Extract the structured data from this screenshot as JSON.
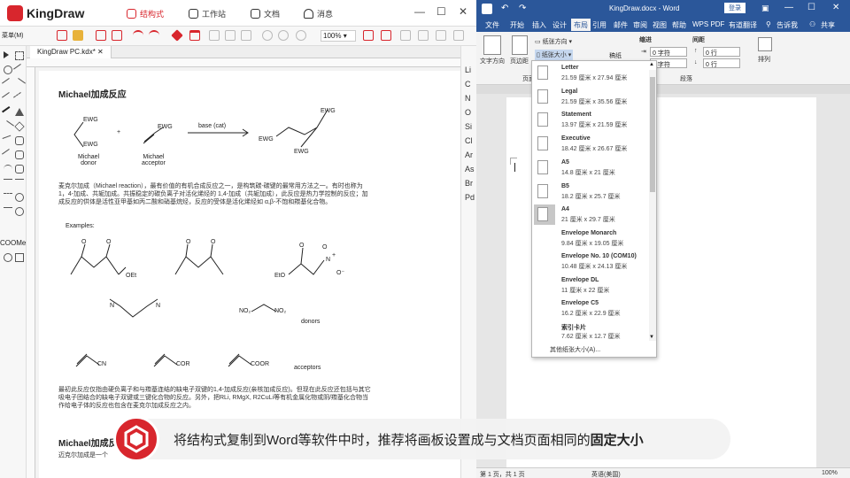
{
  "kingdraw": {
    "brand": "KingDraw",
    "nav": [
      "结构式",
      "工作站",
      "文档",
      "消息"
    ],
    "zoom": "100%",
    "left_labels": [
      "菜单(M)",
      "COOMe"
    ],
    "tab": "KingDraw PC.kdx*",
    "elements": [
      "Li",
      "C",
      "N",
      "O",
      "Si",
      "Cl",
      "Ar",
      "As",
      "Br",
      "Pd"
    ],
    "doc": {
      "title": "Michael加成反应",
      "ewg": "EWG",
      "base": "base (cat)",
      "donor": "Michael\ndonor",
      "acceptor": "Michael\nacceptor",
      "plus": "+",
      "para1": "麦克尔加成（Michael reaction），最有价值的有机合成反应之一，是构筑碳-碳键的最常用方法之一。有时也称为1，4-加成、共轭加成。共振稳定的碳负离子对活化烯烃的 1,4-加成（共轭加成），此反应是热力学控制的反应；加成反应的供体是活性亚甲基如丙二酸和硝基烷烃，反应的受体是活化烯烃如 α,β-不饱和羰基化合物。",
      "examples": "Examples:",
      "oet": "OEt",
      "eto": "EtO",
      "nitro": "N",
      "o_minus": "O⁻",
      "o": "O",
      "plus_charge": "+",
      "donors": "donors",
      "acceptors": "acceptors",
      "cn": "CN",
      "cor": "COR",
      "coor": "COOR",
      "no2": "NO₂",
      "para2": "最初此反应仅指由硬负离子和与羰基连结的缺电子双键的1,4-加成反应(亲核加成反应)。但现在此反应还包括与其它吸电子团结合的缺电子双键或三键化合物的反应。另外，把RLi, RMgX, R2CuLi等有机金属化物或阴/羰基化合物当作给电子体的反应也包含在麦克尔加成反应之内。",
      "title2": "Michael加成反",
      "para3": "迈克尔加成是一个"
    }
  },
  "word": {
    "title": "KingDraw.docx - Word",
    "login": "登录",
    "menus": [
      "文件",
      "开始",
      "插入",
      "设计",
      "布局",
      "引用",
      "邮件",
      "审阅",
      "视图",
      "帮助",
      "WPS PDF",
      "有道翻译",
      "告诉我",
      "共享"
    ],
    "ribbon": {
      "orientation": "纸张方向",
      "size": "纸张大小",
      "text_dir": "文字方向",
      "margins": "页边距",
      "indent": "缩进",
      "spacing": "间距",
      "left": "0 字符",
      "right": "0 字符",
      "before": "0 行",
      "after": "0 行",
      "arrange": "排列",
      "paragraph": "段落",
      "page_setup": "页面",
      "manuscript": "稿纸"
    },
    "status": {
      "page": "第 1 页，共 1 页",
      "lang": "英语(美国)",
      "zoom": "100%"
    },
    "paper_sizes": [
      {
        "name": "Letter",
        "dim": "21.59 厘米 x 27.94 厘米"
      },
      {
        "name": "Legal",
        "dim": "21.59 厘米 x 35.56 厘米"
      },
      {
        "name": "Statement",
        "dim": "13.97 厘米 x 21.59 厘米"
      },
      {
        "name": "Executive",
        "dim": "18.42 厘米 x 26.67 厘米"
      },
      {
        "name": "A5",
        "dim": "14.8 厘米 x 21 厘米"
      },
      {
        "name": "B5",
        "dim": "18.2 厘米 x 25.7 厘米"
      },
      {
        "name": "A4",
        "dim": "21 厘米 x 29.7 厘米"
      },
      {
        "name": "Envelope Monarch",
        "dim": "9.84 厘米 x 19.05 厘米"
      },
      {
        "name": "Envelope No. 10 (COM10)",
        "dim": "10.48 厘米 x 24.13 厘米"
      },
      {
        "name": "Envelope DL",
        "dim": "11 厘米 x 22 厘米"
      },
      {
        "name": "Envelope C5",
        "dim": "16.2 厘米 x 22.9 厘米"
      },
      {
        "name": "索引卡片",
        "dim": "7.62 厘米 x 12.7 厘米"
      }
    ],
    "selected_paper": "A4",
    "more_sizes": "其他纸张大小(A)..."
  },
  "banner": {
    "text": "将结构式复制到Word等软件中时，推荐将画板设置成与文档页面相同的",
    "bold": "固定大小"
  },
  "colors": {
    "kingdraw_red": "#d8262d",
    "word_blue": "#2b579a"
  }
}
